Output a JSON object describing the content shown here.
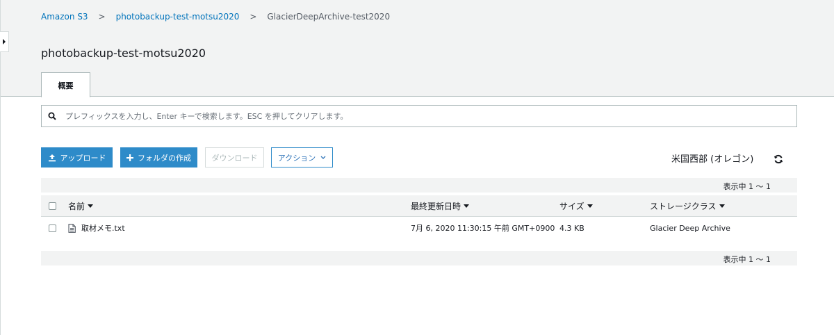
{
  "breadcrumb": {
    "items": [
      "Amazon S3",
      "photobackup-test-motsu2020",
      "GlacierDeepArchive-test2020"
    ],
    "separator": ">"
  },
  "page_title": "photobackup-test-motsu2020",
  "tabs": [
    {
      "label": "概要"
    }
  ],
  "search": {
    "placeholder": "プレフィックスを入力し、Enter キーで検索します。ESC を押してクリアします。",
    "value": ""
  },
  "toolbar": {
    "upload_label": "アップロード",
    "create_folder_label": "フォルダの作成",
    "download_label": "ダウンロード",
    "actions_label": "アクション"
  },
  "region": "米国西部 (オレゴン)",
  "pagination": {
    "label": "表示中 1 ～ 1"
  },
  "table": {
    "columns": [
      "名前",
      "最終更新日時",
      "サイズ",
      "ストレージクラス"
    ],
    "rows": [
      {
        "name": "取材メモ.txt",
        "modified": "7月 6, 2020 11:30:15 午前 GMT+0900",
        "size": "4.3 KB",
        "storage_class": "Glacier Deep Archive"
      }
    ]
  },
  "colors": {
    "link": "#0073bb",
    "primary_button": "#2e8bc9",
    "header_bg": "#f2f3f3",
    "border": "#aab7b8"
  },
  "icons": [
    "expand-arrow-icon",
    "search-icon",
    "upload-icon",
    "plus-icon",
    "chevron-down-icon",
    "refresh-icon",
    "file-icon"
  ]
}
